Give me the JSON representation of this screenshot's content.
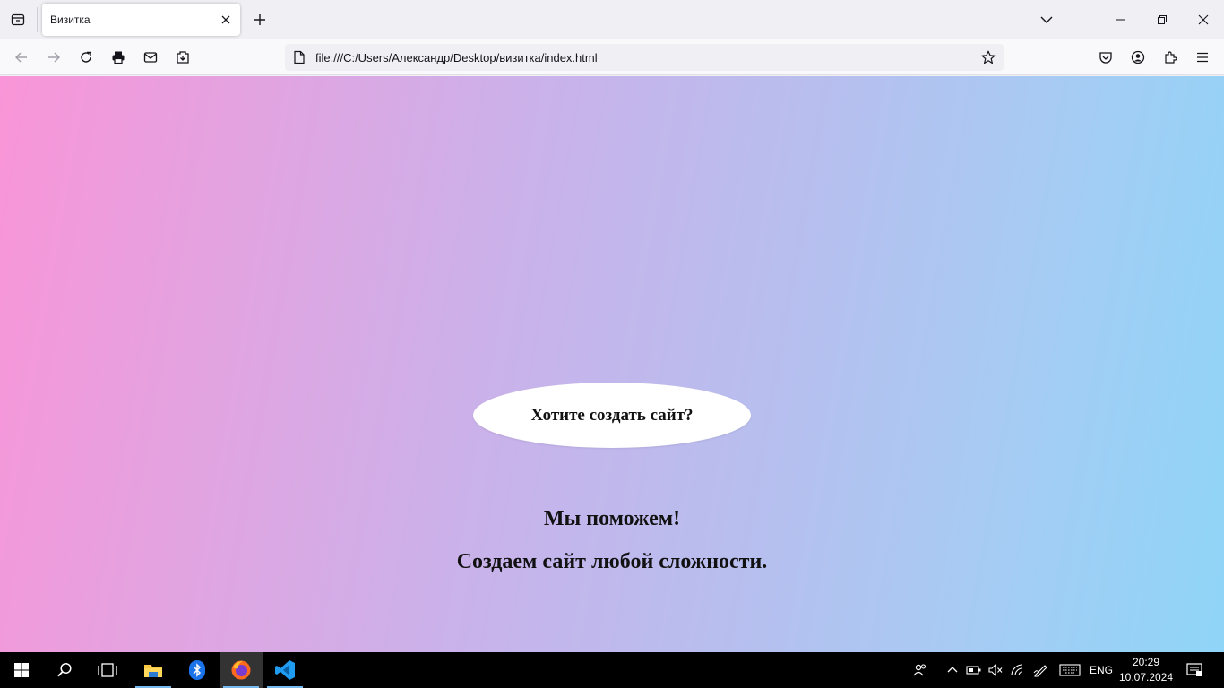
{
  "browser": {
    "tab": {
      "title": "Визитка"
    },
    "url": "file:///C:/Users/Александр/Desktop/визитка/index.html"
  },
  "page": {
    "button_text": "Хотите создать сайт?",
    "line1": "Мы поможем!",
    "line2": "Создаем сайт любой сложности."
  },
  "taskbar": {
    "language": "ENG",
    "time": "20:29",
    "date": "10.07.2024"
  }
}
